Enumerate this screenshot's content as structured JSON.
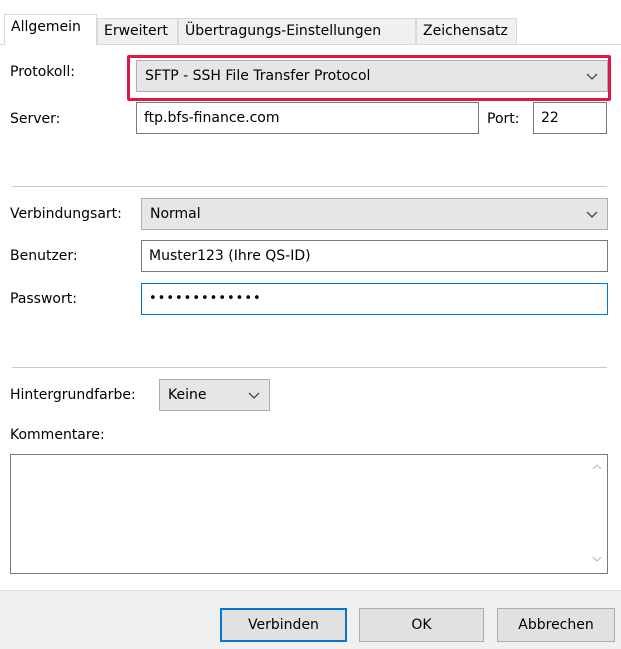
{
  "tabs": [
    {
      "label": "Allgemein",
      "active": true
    },
    {
      "label": "Erweitert",
      "active": false
    },
    {
      "label": "Übertragungs-Einstellungen",
      "active": false
    },
    {
      "label": "Zeichensatz",
      "active": false
    }
  ],
  "protokoll": {
    "label": "Protokoll:",
    "value": "SFTP - SSH File Transfer Protocol",
    "highlight_color": "#e0174a"
  },
  "server": {
    "label": "Server:",
    "value": "ftp.bfs-finance.com"
  },
  "port": {
    "label": "Port:",
    "value": "22"
  },
  "verbindungsart": {
    "label": "Verbindungsart:",
    "value": "Normal"
  },
  "benutzer": {
    "label": "Benutzer:",
    "value": "Muster123 (Ihre QS-ID)"
  },
  "passwort": {
    "label": "Passwort:",
    "value": "•••••••••••••"
  },
  "hintergrundfarbe": {
    "label": "Hintergrundfarbe:",
    "value": "Keine"
  },
  "kommentare": {
    "label": "Kommentare:",
    "value": ""
  },
  "buttons": {
    "connect": "Verbinden",
    "ok": "OK",
    "cancel": "Abbrechen"
  },
  "colors": {
    "focus_border": "#0078d7",
    "highlight": "#e0174a"
  }
}
